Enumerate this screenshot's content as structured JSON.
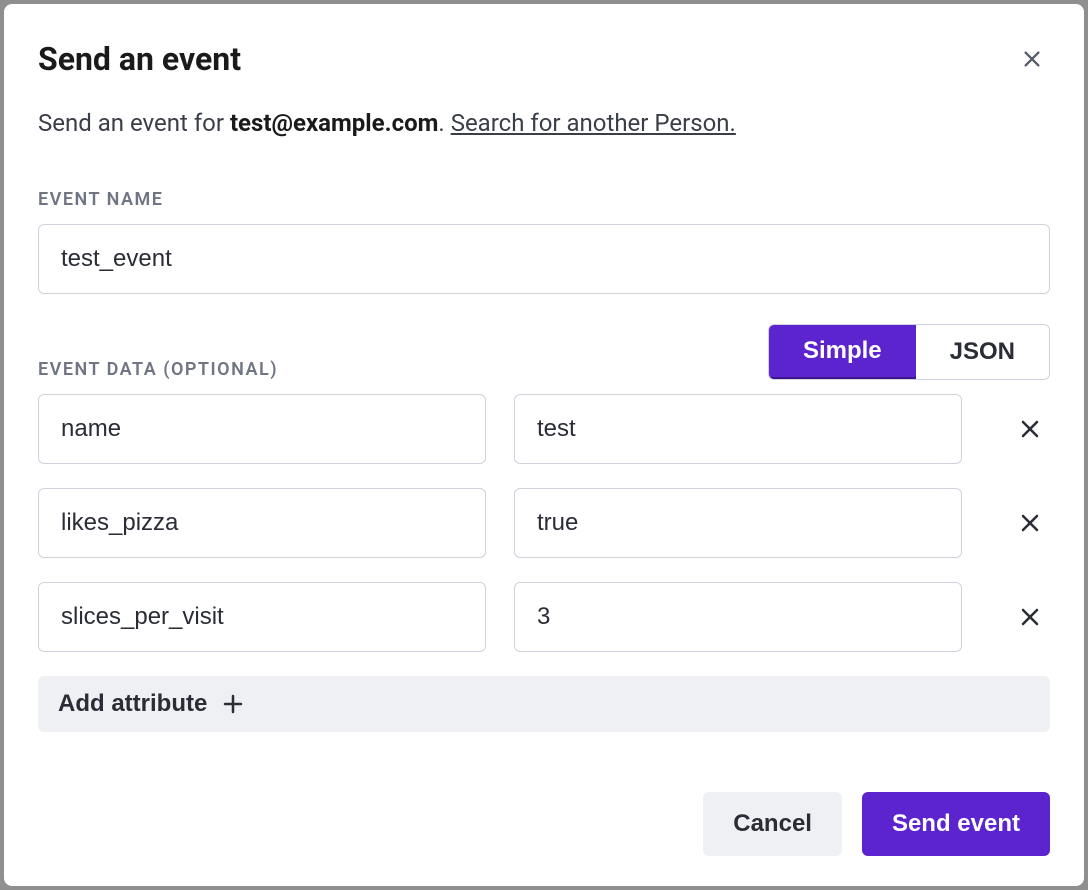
{
  "header": {
    "title": "Send an event"
  },
  "sub": {
    "prefix": "Send an event for ",
    "email": "test@example.com",
    "period": ". ",
    "search_link": "Search for another Person."
  },
  "labels": {
    "event_name": "EVENT NAME",
    "event_data": "EVENT DATA (OPTIONAL)"
  },
  "event_name": {
    "value": "test_event"
  },
  "mode_toggle": {
    "simple": "Simple",
    "json": "JSON",
    "active": "simple"
  },
  "attributes": [
    {
      "key": "name",
      "value": "test"
    },
    {
      "key": "likes_pizza",
      "value": "true"
    },
    {
      "key": "slices_per_visit",
      "value": "3"
    }
  ],
  "buttons": {
    "add_attribute": "Add attribute",
    "cancel": "Cancel",
    "send": "Send event"
  }
}
